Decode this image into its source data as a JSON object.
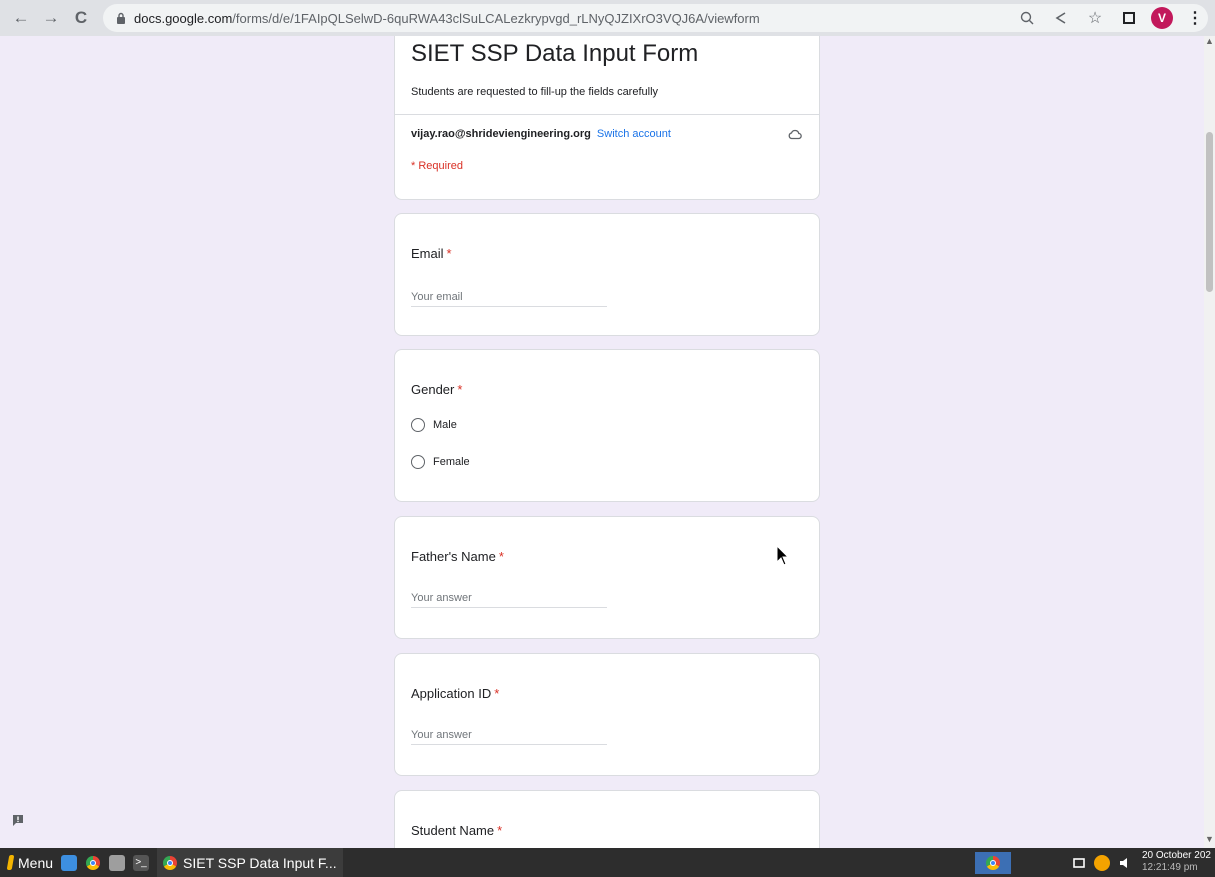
{
  "browser": {
    "url_host": "docs.google.com",
    "url_path": "/forms/d/e/1FAIpQLSelwD-6quRWA43clSuLCALezkrypvgd_rLNyQJZIXrO3VQJ6A/viewform",
    "avatar_letter": "V"
  },
  "form": {
    "title": "SIET SSP Data Input Form",
    "description": "Students are requested to fill-up the fields carefully",
    "account_email": "vijay.rao@shrideviengineering.org",
    "switch_account": "Switch account",
    "required_note": "* Required",
    "questions": {
      "email": {
        "label": "Email",
        "placeholder": "Your email"
      },
      "gender": {
        "label": "Gender",
        "options": [
          "Male",
          "Female"
        ]
      },
      "father_name": {
        "label": "Father's Name",
        "placeholder": "Your answer"
      },
      "application_id": {
        "label": "Application ID",
        "placeholder": "Your answer"
      },
      "student_name": {
        "label": "Student Name"
      }
    },
    "required_star": "*"
  },
  "taskbar": {
    "menu_label": "Menu",
    "window_title": "SIET SSP Data Input F...",
    "date": "20 October 202",
    "time": "12:21:49 pm"
  },
  "colors": {
    "page_bg": "#f0ebf8",
    "required": "#d93025",
    "link": "#1a73e8",
    "avatar": "#c2185b"
  }
}
